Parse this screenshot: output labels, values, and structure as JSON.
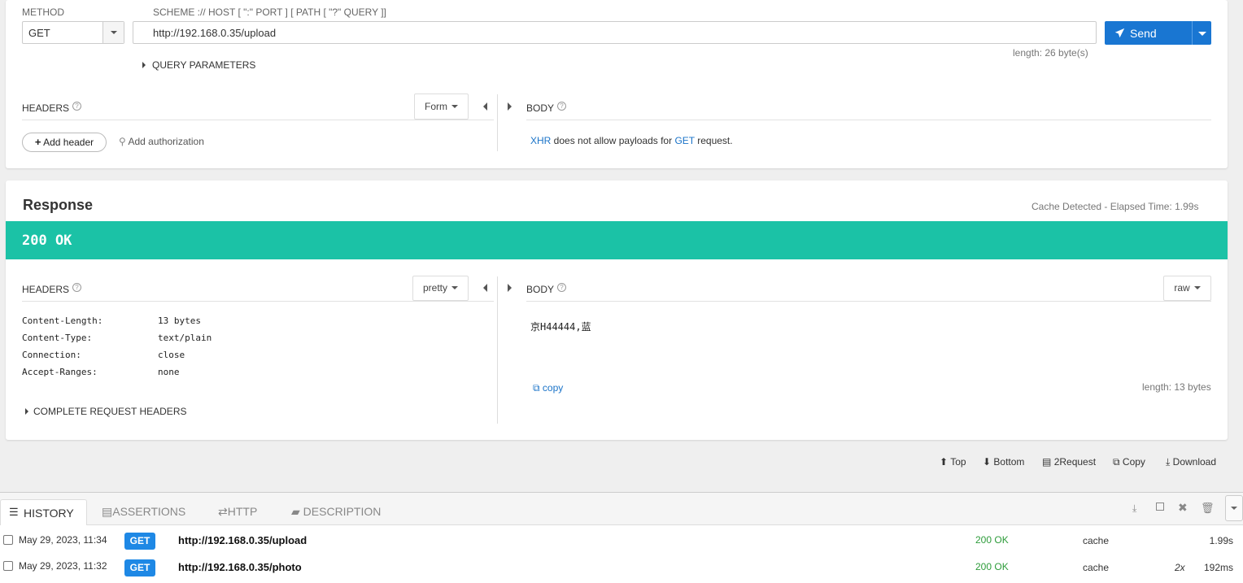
{
  "request": {
    "method_label": "METHOD",
    "method_value": "GET",
    "url_label": "SCHEME :// HOST [ \":\" PORT ] [ PATH [ \"?\" QUERY ]]",
    "url_value": "http://192.168.0.35/upload",
    "url_length": "length: 26 byte(s)",
    "send_label": "Send",
    "query_params_label": "QUERY PARAMETERS",
    "headers_label": "HEADERS",
    "form_label": "Form",
    "add_header_label": "Add header",
    "add_auth_label": "Add authorization",
    "body_label": "BODY",
    "body_msg": {
      "xhr": "XHR",
      "mid": " does not allow payloads for ",
      "get": "GET",
      "end": " request."
    }
  },
  "response": {
    "title": "Response",
    "cache_info": "Cache Detected - Elapsed Time: 1.99s",
    "status_text": "200 OK",
    "status_color": "#1bc2a6",
    "headers_label": "HEADERS",
    "pretty_label": "pretty",
    "headers": [
      {
        "name": "Content-Length:",
        "value": "13 bytes"
      },
      {
        "name": "Content-Type:",
        "value": "text/plain"
      },
      {
        "name": "Connection:",
        "value": "close"
      },
      {
        "name": "Accept-Ranges:",
        "value": "none"
      }
    ],
    "complete_headers_label": "COMPLETE REQUEST HEADERS",
    "body_label": "BODY",
    "raw_label": "raw",
    "body_content": "京H44444,蓝",
    "copy_label": "copy",
    "body_length": "length: 13 bytes"
  },
  "actions": {
    "top": "Top",
    "bottom": "Bottom",
    "to_request": "2Request",
    "copy": "Copy",
    "download": "Download"
  },
  "bottom_tabs": {
    "history": "HISTORY",
    "assertions": "ASSERTIONS",
    "http": "HTTP",
    "description": "DESCRIPTION"
  },
  "history": [
    {
      "date": "May 29, 2023, 11:34",
      "method": "GET",
      "url": "http://192.168.0.35/upload",
      "status": "200 OK",
      "source": "cache",
      "count": "",
      "time": "1.99s"
    },
    {
      "date": "May 29, 2023, 11:32",
      "method": "GET",
      "url": "http://192.168.0.35/photo",
      "status": "200 OK",
      "source": "cache",
      "count": "2x",
      "time": "192ms"
    }
  ],
  "colors": {
    "accent": "#1e88e5",
    "send_button": "#1976d2",
    "status_ok": "#1bc2a6",
    "history_ok": "#2e9c3b"
  }
}
